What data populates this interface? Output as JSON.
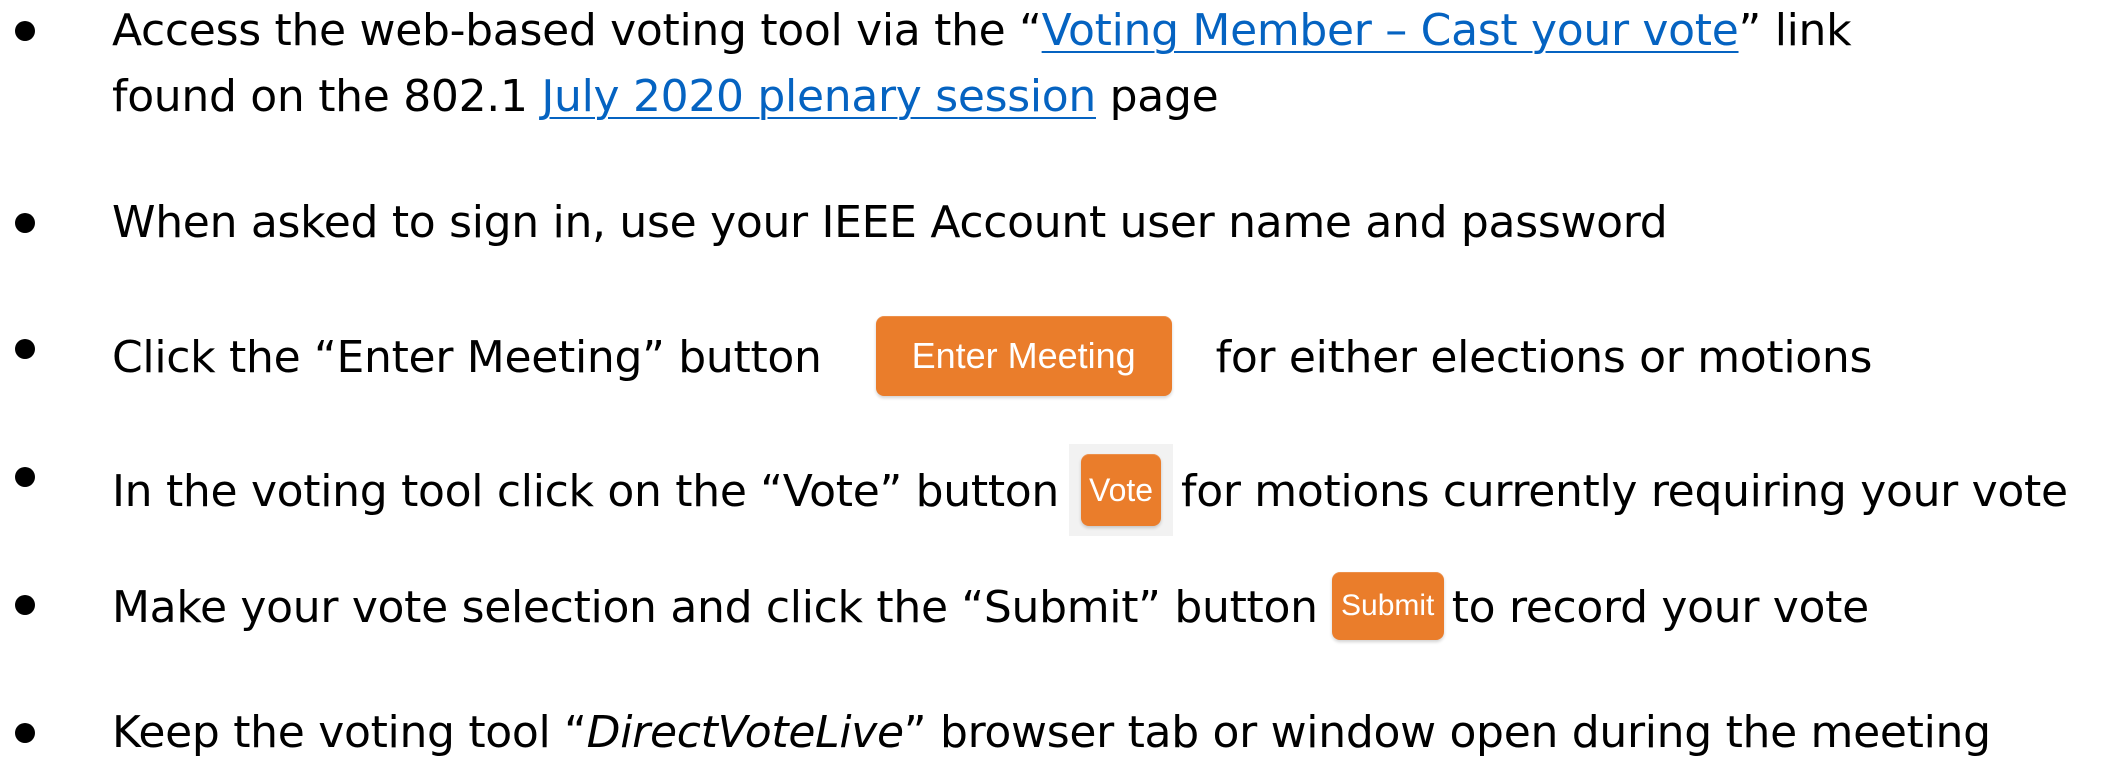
{
  "bullets": [
    {
      "line1_before": "Access the web-based voting tool via the “",
      "line1_link": "Voting Member – Cast your vote",
      "line1_after": "” link",
      "line2_before": "found on the 802.1 ",
      "line2_link": "July 2020 plenary session",
      "line2_after": " page"
    },
    {
      "text": "When asked to sign in, use your IEEE Account user name and password"
    },
    {
      "before": "Click the “Enter Meeting” button",
      "button_label": "Enter Meeting",
      "after": "for either elections or motions"
    },
    {
      "before": "In the voting tool click on the “Vote” button",
      "button_label": "Vote",
      "after": "for motions currently requiring your vote"
    },
    {
      "before": "Make your vote selection and click the “Submit” button",
      "button_label": "Submit",
      "after": "to record your vote"
    },
    {
      "before": "Keep the voting tool “",
      "italic": "DirectVoteLive",
      "after": "” browser tab or window open during the meeting"
    }
  ],
  "colors": {
    "link": "#0563c1",
    "button": "#ea7d2b",
    "text": "#000000"
  }
}
